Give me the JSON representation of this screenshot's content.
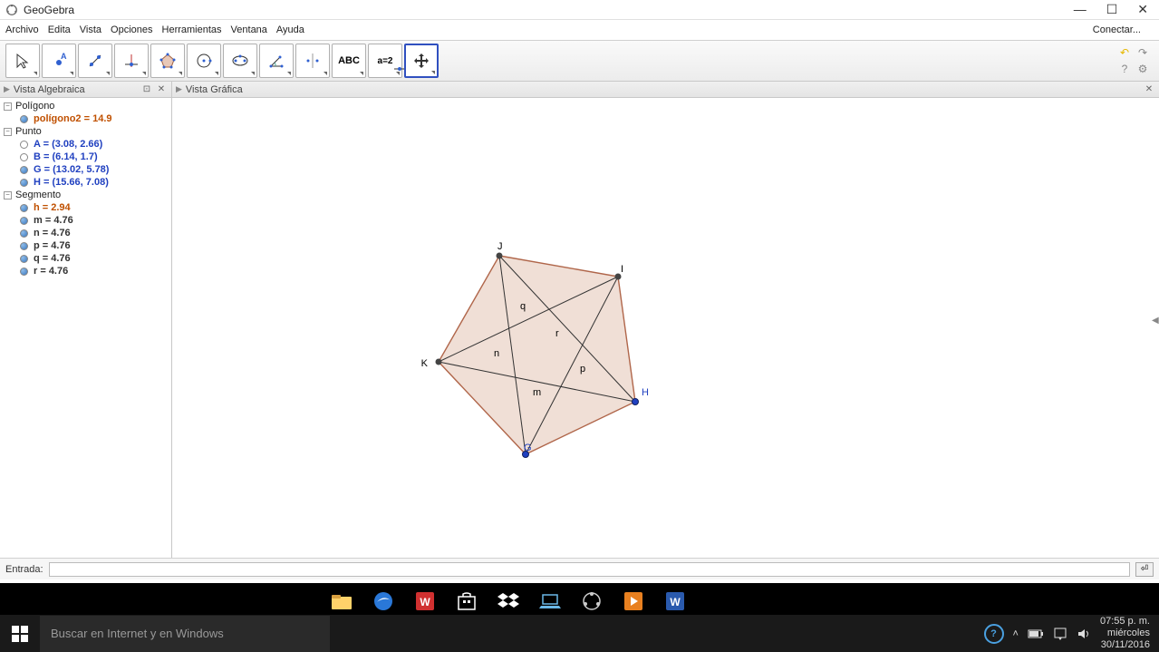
{
  "window": {
    "title": "GeoGebra",
    "connect": "Conectar..."
  },
  "menu": {
    "archivo": "Archivo",
    "edita": "Edita",
    "vista": "Vista",
    "opciones": "Opciones",
    "herramientas": "Herramientas",
    "ventana": "Ventana",
    "ayuda": "Ayuda"
  },
  "toolbar": {
    "abc": "ABC",
    "a2": "a=2"
  },
  "panels": {
    "algebra_title": "Vista Algebraica",
    "graphics_title": "Vista Gráfica"
  },
  "tree": {
    "poligono_cat": "Polígono",
    "poligono2": "polígono2 = 14.9",
    "punto_cat": "Punto",
    "A": "A = (3.08, 2.66)",
    "B": "B = (6.14, 1.7)",
    "G": "G = (13.02, 5.78)",
    "H": "H = (15.66, 7.08)",
    "segmento_cat": "Segmento",
    "h": "h = 2.94",
    "m": "m = 4.76",
    "n": "n = 4.76",
    "p": "p = 4.76",
    "q": "q = 4.76",
    "r": "r = 4.76"
  },
  "graph": {
    "labels": {
      "J": "J",
      "I": "I",
      "K": "K",
      "H": "H",
      "G": "G",
      "q": "q",
      "r": "r",
      "n": "n",
      "p": "p",
      "m": "m"
    }
  },
  "input": {
    "label": "Entrada:",
    "value": "",
    "btn": "⏎"
  },
  "taskbar": {
    "search_placeholder": "Buscar en Internet y en Windows",
    "time": "07:55 p. m.",
    "day": "miércoles",
    "date": "30/11/2016"
  }
}
